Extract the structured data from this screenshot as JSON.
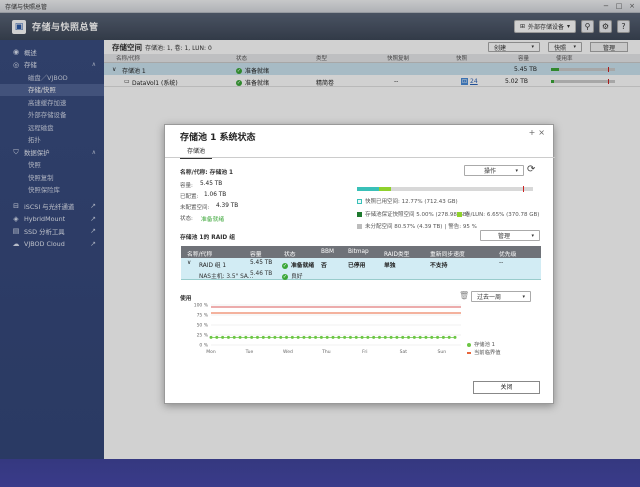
{
  "window": {
    "title": "存储与快照总管"
  },
  "header": {
    "app_title": "存储与快照总管",
    "ext_storage_btn": "外部存储设备"
  },
  "sidebar": {
    "items": [
      {
        "label": "概述",
        "icon": "overview-icon"
      },
      {
        "label": "存储",
        "icon": "storage-icon"
      },
      {
        "label": "磁盘／VJBOD",
        "sub": true
      },
      {
        "label": "存储/快照",
        "sub": true,
        "active": true
      },
      {
        "label": "高速缓存加速",
        "sub": true
      },
      {
        "label": "外部存储设备",
        "sub": true
      },
      {
        "label": "远程磁盘",
        "sub": true
      },
      {
        "label": "拓扑",
        "sub": true
      },
      {
        "label": "数据保护",
        "icon": "shield-icon"
      },
      {
        "label": "快照",
        "sub": true
      },
      {
        "label": "快照复制",
        "sub": true
      },
      {
        "label": "快照保险库",
        "sub": true
      },
      {
        "label": "iSCSI 与光纤通道",
        "icon": "iscsi-icon"
      },
      {
        "label": "HybridMount",
        "icon": "hybridmount-icon"
      },
      {
        "label": "SSD 分析工具",
        "icon": "ssd-icon"
      },
      {
        "label": "VJBOD Cloud",
        "icon": "cloud-icon"
      }
    ]
  },
  "main": {
    "title": "存储空间",
    "subtitle": "存储池: 1, 卷: 1, LUN: 0",
    "btn_create": "创建",
    "btn_snapshot": "快照",
    "btn_manage": "管理",
    "columns": [
      "名称/代称",
      "状态",
      "类型",
      "快照复制",
      "快照",
      "容量",
      "使用率"
    ],
    "rows": [
      {
        "name": "存储池 1",
        "status": "准备就绪",
        "type": "",
        "replica": "",
        "snap": "",
        "capacity": "5.45 TB",
        "usage": 0.13
      },
      {
        "name": "DataVol1 (系统)",
        "status": "准备就绪",
        "type": "精简卷",
        "replica": "--",
        "snap": "24",
        "capacity": "5.02 TB",
        "usage": 0.05
      }
    ]
  },
  "modal": {
    "title": "存储池 1 系统状态",
    "tab": "存储池",
    "name_label": "名称/代称: 存储池 1",
    "capacity_label": "容量:",
    "capacity_value": "5.45 TB",
    "allocated_label": "已配置:",
    "allocated_value": "1.06 TB",
    "unallocated_label": "未配置空间:",
    "unallocated_value": "4.39 TB",
    "status_label": "状态:",
    "status_value": "准备就绪",
    "action_btn": "操作",
    "legend_snapshot": "快照已用空间: 12.77% (712.43 GB)",
    "legend_guaranteed": "存储池保证快照空间 5.00% (278.98 GB)",
    "legend_volume": "卷/LUN: 6.65% (370.78 GB)",
    "legend_unallocated": "未分配空间 80.57% (4.39 TB)",
    "legend_warning": "警告: 95 %",
    "raid_title": "存储池 1的 RAID 组",
    "raid_manage_btn": "管理",
    "raid_columns": [
      "名称/代称",
      "容量",
      "状态",
      "BBM",
      "Bitmap",
      "RAID类型",
      "重新同步速度",
      "优先级"
    ],
    "raid_rows": [
      {
        "name": "RAID 组 1",
        "capacity": "5.45 TB",
        "status": "准备就绪",
        "bbm": "否",
        "bitmap": "已停用",
        "raid": "单独",
        "resync": "不支持",
        "priority": "--"
      },
      {
        "name": "NAS主机: 3.5\" SA...",
        "capacity": "5.46 TB",
        "status": "良好"
      }
    ],
    "usage_label": "使用",
    "period_dropdown": "过去一周",
    "y_ticks": [
      "100 %",
      "75 %",
      "50 %",
      "25 %",
      "0 %"
    ],
    "x_ticks": [
      "Mon",
      "Tue",
      "Wed",
      "Thu",
      "Fri",
      "Sat",
      "Sun"
    ],
    "series_label": "存储池 1",
    "threshold_label": "当前临界值",
    "close_btn": "关闭"
  },
  "chart_data": {
    "type": "line",
    "title": "",
    "xlabel": "",
    "ylabel": "",
    "ylim": [
      0,
      100
    ],
    "categories": [
      "Mon",
      "Tue",
      "Wed",
      "Thu",
      "Fri",
      "Sat",
      "Sun"
    ],
    "series": [
      {
        "name": "存储池 1",
        "values": [
          19,
          19,
          19,
          19,
          19,
          19,
          19,
          19,
          19,
          19,
          19,
          19,
          19,
          19,
          19,
          19,
          19,
          19,
          19,
          19,
          19,
          19,
          19,
          19,
          19,
          19,
          19,
          19,
          19,
          19,
          19,
          19,
          19,
          19,
          19,
          19,
          19,
          19,
          19,
          19,
          19,
          19,
          19
        ]
      },
      {
        "name": "当前临界值",
        "values": [
          80
        ]
      }
    ],
    "colors": {
      "usage": "#6cc644",
      "threshold": "#e8663c",
      "red_line": "#cc2222"
    }
  }
}
